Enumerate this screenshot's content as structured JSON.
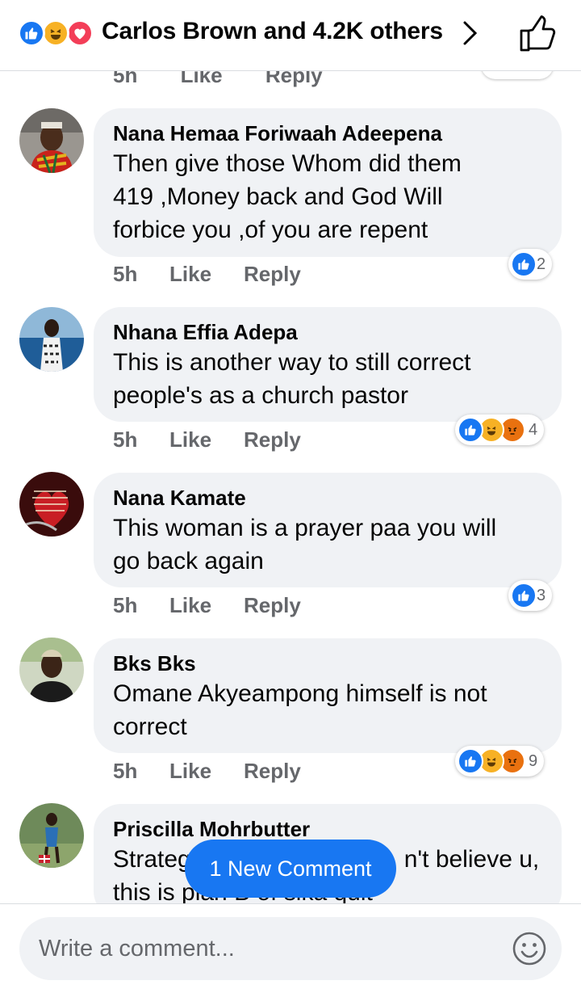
{
  "header": {
    "reactions": [
      "like",
      "haha",
      "love"
    ],
    "reacted_by": "Carlos Brown and 4.2K others",
    "icons": {
      "chevron": "chevron-right-icon",
      "like_button": "thumbs-up-outline-icon"
    }
  },
  "partial_previous": {
    "time": "5h",
    "like": "Like",
    "reply": "Reply"
  },
  "comments": [
    {
      "author": "Nana Hemaa Foriwaah Adeepena",
      "text_lines": [
        "Then give those Whom did them",
        "419 ,Money back and God Will",
        "forbice you ,of you are repent"
      ],
      "time": "5h",
      "like_label": "Like",
      "reply_label": "Reply",
      "reactions": [
        "like"
      ],
      "reaction_count": "2"
    },
    {
      "author": "Nhana Effia Adepa",
      "text_lines": [
        "This is another way to still correct",
        "people's as a church pastor"
      ],
      "time": "5h",
      "like_label": "Like",
      "reply_label": "Reply",
      "reactions": [
        "like",
        "haha",
        "angry"
      ],
      "reaction_count": "4"
    },
    {
      "author": "Nana Kamate",
      "text_lines": [
        "This woman  is a prayer paa you will",
        "go back again"
      ],
      "time": "5h",
      "like_label": "Like",
      "reply_label": "Reply",
      "reactions": [
        "like"
      ],
      "reaction_count": "3"
    },
    {
      "author": "Bks Bks",
      "text_lines": [
        "Omane Akyeampong himself is not",
        "correct"
      ],
      "time": "5h",
      "like_label": "Like",
      "reply_label": "Reply",
      "reactions": [
        "like",
        "haha",
        "angry"
      ],
      "reaction_count": "9"
    },
    {
      "author": "Priscilla Mohrbutter",
      "text_lines": [
        "Strateg",
        "n't believe u,",
        "this is plan B of sika quit"
      ]
    }
  ],
  "new_comment_pill": "1 New Comment",
  "composer": {
    "placeholder": "Write a comment...",
    "emoji_icon": "smiley-icon"
  },
  "colors": {
    "accent": "#1877f2",
    "bubble": "#f0f2f5",
    "meta": "#65676b"
  }
}
